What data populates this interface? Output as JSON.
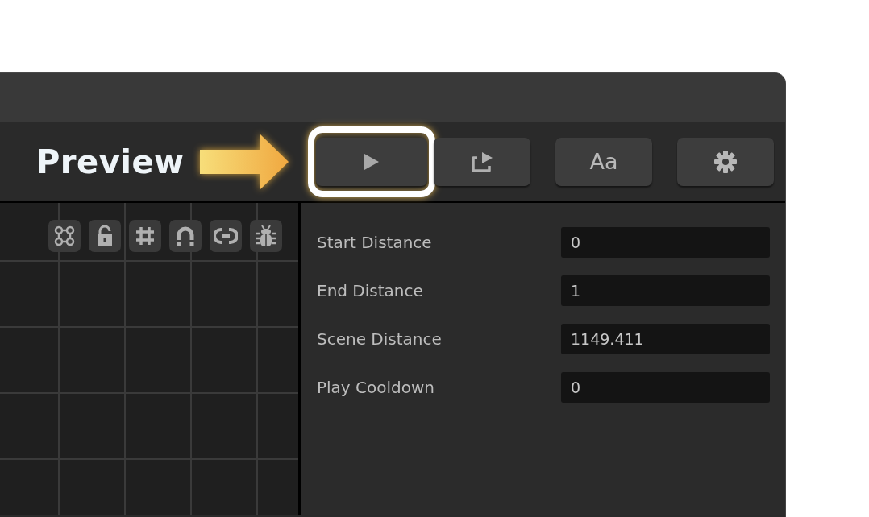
{
  "toolbar": {
    "title": "Preview",
    "buttons": [
      {
        "kind": "play",
        "highlighted": true
      },
      {
        "kind": "share",
        "highlighted": false
      },
      {
        "kind": "text",
        "label": "Aa",
        "highlighted": false
      },
      {
        "kind": "settings",
        "highlighted": false
      }
    ]
  },
  "canvas_tools": [
    {
      "kind": "nodes"
    },
    {
      "kind": "lock"
    },
    {
      "kind": "grid"
    },
    {
      "kind": "magnet"
    },
    {
      "kind": "link"
    },
    {
      "kind": "bug"
    }
  ],
  "properties": [
    {
      "label": "Start Distance",
      "value": "0"
    },
    {
      "label": "End Distance",
      "value": "1"
    },
    {
      "label": "Scene Distance",
      "value": "1149.411"
    },
    {
      "label": "Play Cooldown",
      "value": "0"
    }
  ]
}
